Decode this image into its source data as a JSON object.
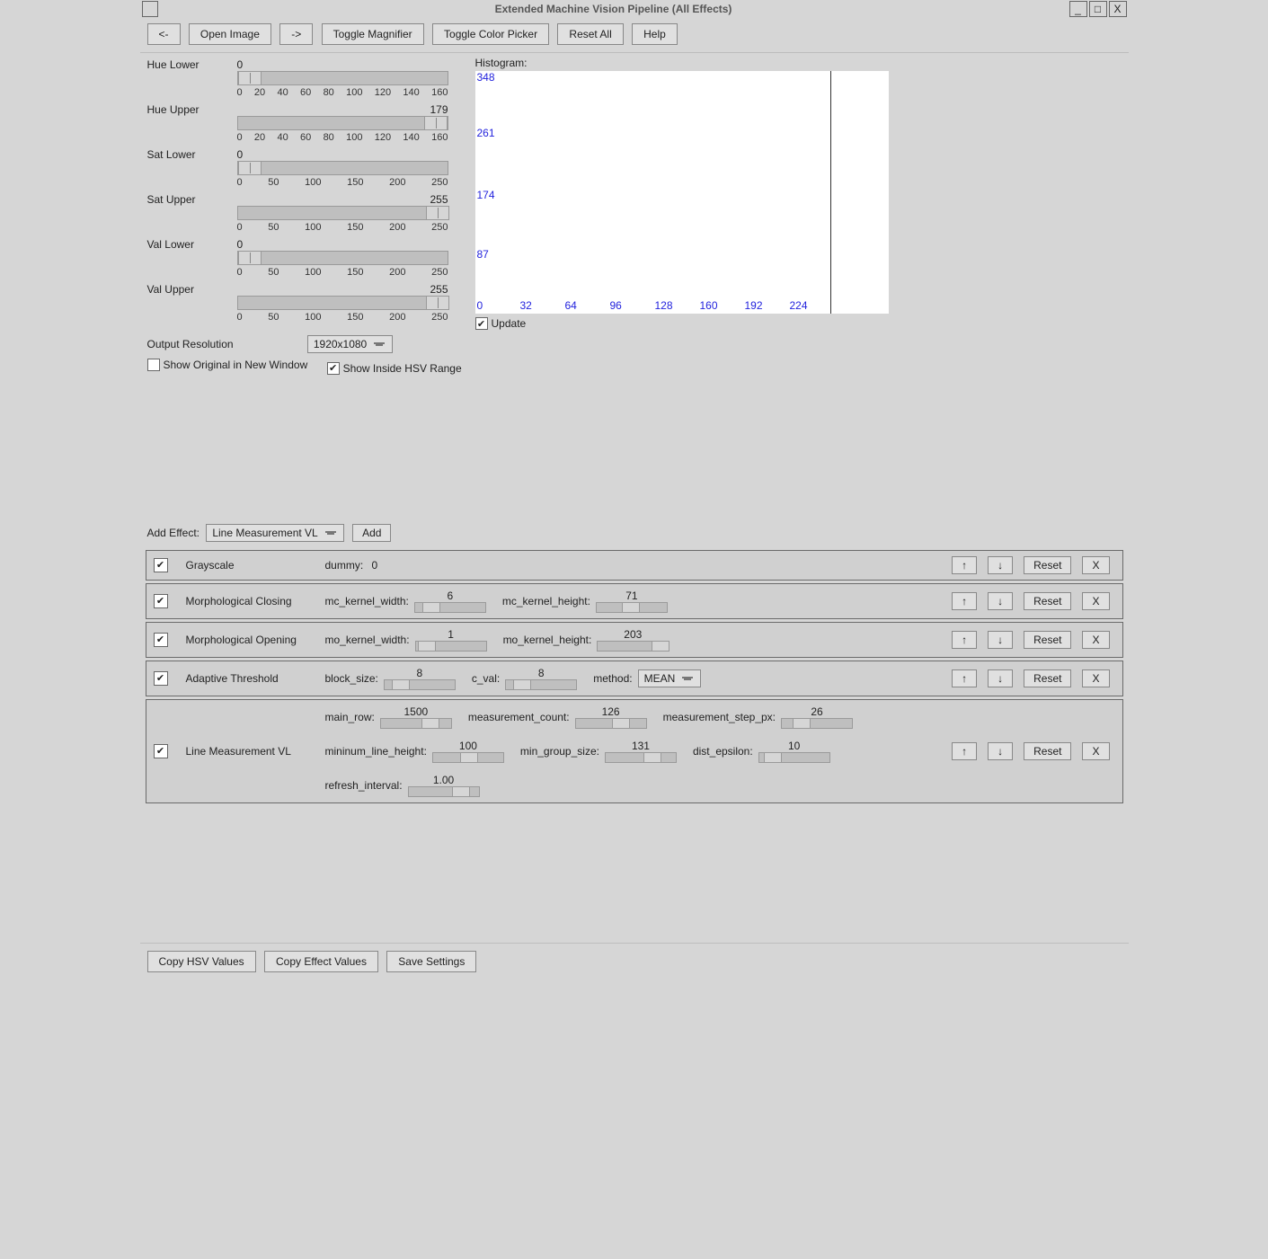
{
  "title": "Extended Machine Vision Pipeline (All Effects)",
  "window_buttons": {
    "min": "_",
    "max": "□",
    "close": "X"
  },
  "toolbar": {
    "back": "<-",
    "open": "Open Image",
    "fwd": "->",
    "magnifier": "Toggle Magnifier",
    "colorpicker": "Toggle Color Picker",
    "reset": "Reset All",
    "help": "Help"
  },
  "sliders": {
    "hue_lower": {
      "label": "Hue Lower",
      "value": 0,
      "max": 180,
      "ticks": [
        "0",
        "20",
        "40",
        "60",
        "80",
        "100",
        "120",
        "140",
        "160"
      ]
    },
    "hue_upper": {
      "label": "Hue Upper",
      "value": 179,
      "max": 180,
      "ticks": [
        "0",
        "20",
        "40",
        "60",
        "80",
        "100",
        "120",
        "140",
        "160"
      ]
    },
    "sat_lower": {
      "label": "Sat Lower",
      "value": 0,
      "max": 255,
      "ticks": [
        "0",
        "50",
        "100",
        "150",
        "200",
        "250"
      ]
    },
    "sat_upper": {
      "label": "Sat Upper",
      "value": 255,
      "max": 255,
      "ticks": [
        "0",
        "50",
        "100",
        "150",
        "200",
        "250"
      ]
    },
    "val_lower": {
      "label": "Val Lower",
      "value": 0,
      "max": 255,
      "ticks": [
        "0",
        "50",
        "100",
        "150",
        "200",
        "250"
      ]
    },
    "val_upper": {
      "label": "Val Upper",
      "value": 255,
      "max": 255,
      "ticks": [
        "0",
        "50",
        "100",
        "150",
        "200",
        "250"
      ]
    }
  },
  "output_resolution": {
    "label": "Output Resolution",
    "value": "1920x1080"
  },
  "show_original": {
    "label": "Show Original in New Window",
    "checked": false
  },
  "show_inside": {
    "label": "Show Inside HSV Range",
    "checked": true
  },
  "histogram": {
    "label": "Histogram:",
    "y": [
      "348",
      "261",
      "174",
      "87",
      "0"
    ],
    "x": [
      "0",
      "32",
      "64",
      "96",
      "128",
      "160",
      "192",
      "224"
    ],
    "update_label": "Update",
    "update_checked": true
  },
  "add_effect": {
    "label": "Add Effect:",
    "value": "Line Measurement VL",
    "add": "Add"
  },
  "actions": {
    "up": "↑",
    "down": "↓",
    "reset": "Reset",
    "remove": "X"
  },
  "effects": [
    {
      "name": "Grayscale",
      "params": [
        {
          "label": "dummy:",
          "value": 0,
          "slider": false
        }
      ]
    },
    {
      "name": "Morphological Closing",
      "params": [
        {
          "label": "mc_kernel_width:",
          "value": 6,
          "pos": 8
        },
        {
          "label": "mc_kernel_height:",
          "value": 71,
          "pos": 28
        }
      ]
    },
    {
      "name": "Morphological Opening",
      "params": [
        {
          "label": "mo_kernel_width:",
          "value": 1,
          "pos": 2
        },
        {
          "label": "mo_kernel_height:",
          "value": 203,
          "pos": 60
        }
      ]
    },
    {
      "name": "Adaptive Threshold",
      "params": [
        {
          "label": "block_size:",
          "value": 8,
          "pos": 8
        },
        {
          "label": "c_val:",
          "value": 8,
          "pos": 8
        },
        {
          "label": "method:",
          "value": "MEAN",
          "dropdown": true
        }
      ]
    },
    {
      "name": "Line Measurement VL",
      "params": [
        {
          "label": "main_row:",
          "value": 1500,
          "pos": 45
        },
        {
          "label": "measurement_count:",
          "value": 126,
          "pos": 40
        },
        {
          "label": "measurement_step_px:",
          "value": 26,
          "pos": 12
        },
        {
          "label": "mininum_line_height:",
          "value": 100,
          "pos": 30
        },
        {
          "label": "min_group_size:",
          "value": 131,
          "pos": 42
        },
        {
          "label": "dist_epsilon:",
          "value": 10,
          "pos": 5
        },
        {
          "label": "refresh_interval:",
          "value": "1.00",
          "pos": 48
        }
      ]
    }
  ],
  "footer": {
    "copy_hsv": "Copy HSV Values",
    "copy_effect": "Copy Effect Values",
    "save": "Save Settings"
  },
  "chart_data": {
    "type": "bar",
    "title": "Histogram:",
    "xlabel": "",
    "ylabel": "",
    "x_ticks": [
      0,
      32,
      64,
      96,
      128,
      160,
      192,
      224
    ],
    "y_ticks": [
      0,
      87,
      174,
      261,
      348
    ],
    "xlim": [
      0,
      255
    ],
    "ylim": [
      0,
      348
    ],
    "series": [
      {
        "name": "histogram",
        "values": []
      }
    ],
    "note": "No bars visible; vertical marker near x≈224"
  }
}
